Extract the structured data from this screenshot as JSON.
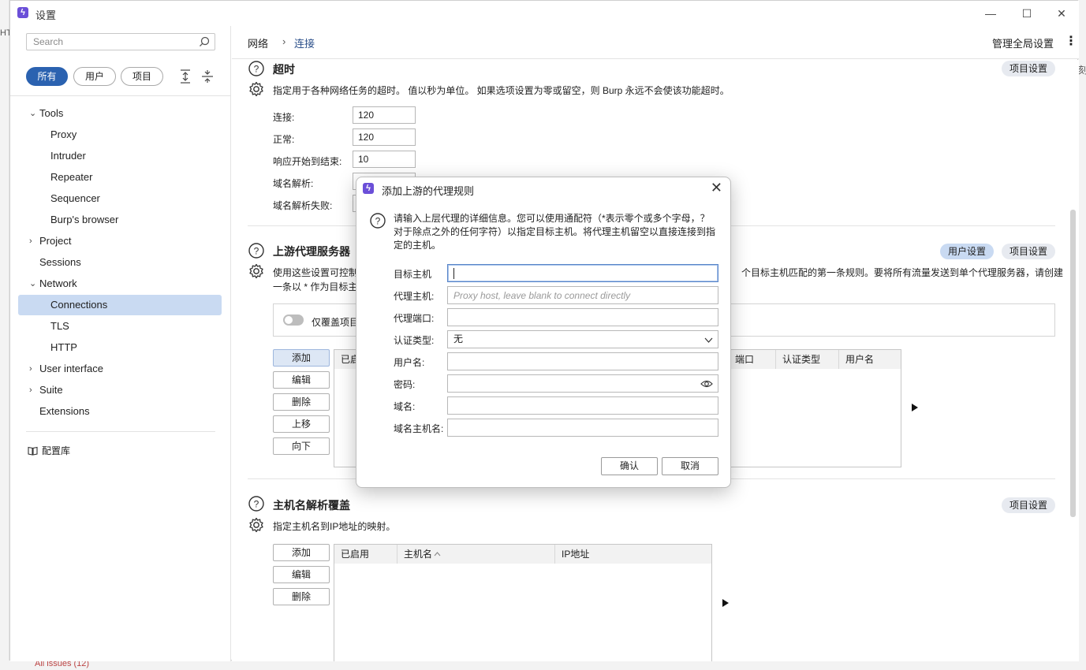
{
  "window": {
    "title": "设置",
    "minimize": "—",
    "maximize": "☐",
    "close": "✕",
    "icon": "burp-lightning-icon"
  },
  "sidebar": {
    "search_placeholder": "Search",
    "filters": [
      {
        "label": "所有",
        "active": true
      },
      {
        "label": "用户",
        "active": false
      },
      {
        "label": "项目",
        "active": false
      }
    ],
    "tree": [
      {
        "label": "Tools",
        "level": 0,
        "caret": "open"
      },
      {
        "label": "Proxy",
        "level": 1
      },
      {
        "label": "Intruder",
        "level": 1
      },
      {
        "label": "Repeater",
        "level": 1
      },
      {
        "label": "Sequencer",
        "level": 1
      },
      {
        "label": "Burp's browser",
        "level": 1
      },
      {
        "label": "Project",
        "level": 0,
        "caret": "closed"
      },
      {
        "label": "Sessions",
        "level": 0
      },
      {
        "label": "Network",
        "level": 0,
        "caret": "open"
      },
      {
        "label": "Connections",
        "level": 1,
        "selected": true
      },
      {
        "label": "TLS",
        "level": 1
      },
      {
        "label": "HTTP",
        "level": 1
      },
      {
        "label": "User interface",
        "level": 0,
        "caret": "closed"
      },
      {
        "label": "Suite",
        "level": 0,
        "caret": "closed"
      },
      {
        "label": "Extensions",
        "level": 0
      }
    ],
    "library_label": "配置库"
  },
  "header": {
    "crumb_root": "网络",
    "crumb_sep": "›",
    "crumb_current": "连接",
    "global_settings": "管理全局设置",
    "more": "⋮"
  },
  "timeouts": {
    "title": "超时",
    "tag": "项目设置",
    "desc": "指定用于各种网络任务的超时。 值以秒为单位。 如果选项设置为零或留空，则 Burp 永远不会使该功能超时。",
    "fields": [
      {
        "label": "连接:",
        "value": "120"
      },
      {
        "label": "正常:",
        "value": "120"
      },
      {
        "label": "响应开始到结束:",
        "value": "10"
      },
      {
        "label": "域名解析:",
        "value": ""
      },
      {
        "label": "域名解析失败:",
        "value": ""
      }
    ]
  },
  "upstream": {
    "title": "上游代理服务器",
    "tag_user": "用户设置",
    "tag_project": "项目设置",
    "desc_left": "使用这些设置可控制",
    "desc_right": "个目标主机匹配的第一条规则。要将所有流量发送到单个代理服务器，请创建",
    "desc_line2": "一条以 * 作为目标主",
    "toggle_label": "仅覆盖项目",
    "buttons": [
      "添加",
      "编辑",
      "删除",
      "上移",
      "向下"
    ],
    "columns_left": [
      "已启"
    ],
    "columns_right": [
      "端口",
      "认证类型",
      "用户名"
    ]
  },
  "hostname": {
    "title": "主机名解析覆盖",
    "tag": "项目设置",
    "desc": "指定主机名到IP地址的映射。",
    "buttons": [
      "添加",
      "编辑",
      "删除"
    ],
    "columns": [
      "已启用",
      "主机名",
      "IP地址"
    ]
  },
  "dialog": {
    "title": "添加上游的代理规则",
    "close": "✕",
    "desc_line1": "请输入上层代理的详细信息。您可以使用通配符（*表示零个或多个字母，？",
    "desc_line2": "对于除点之外的任何字符）以指定目标主机。将代理主机留空以直接连接到指",
    "desc_line3": "定的主机。",
    "fields": {
      "target_host_label": "目标主机",
      "target_host_value": "",
      "proxy_host_label": "代理主机:",
      "proxy_host_placeholder": "Proxy host, leave blank to connect directly",
      "proxy_port_label": "代理端口:",
      "auth_type_label": "认证类型:",
      "auth_type_value": "无",
      "username_label": "用户名:",
      "password_label": "密码:",
      "domain_label": "域名:",
      "domain_host_label": "域名主机名:"
    },
    "ok": "确认",
    "cancel": "取消"
  },
  "background": {
    "left_text": "HT",
    "right_text": "刻",
    "bottom_text": "All issues (12)"
  },
  "colors": {
    "accent": "#2b62b0",
    "selected": "#c9daf2",
    "tag_bg": "#e7eaf0",
    "burp_icon": "#6b4fd8"
  }
}
